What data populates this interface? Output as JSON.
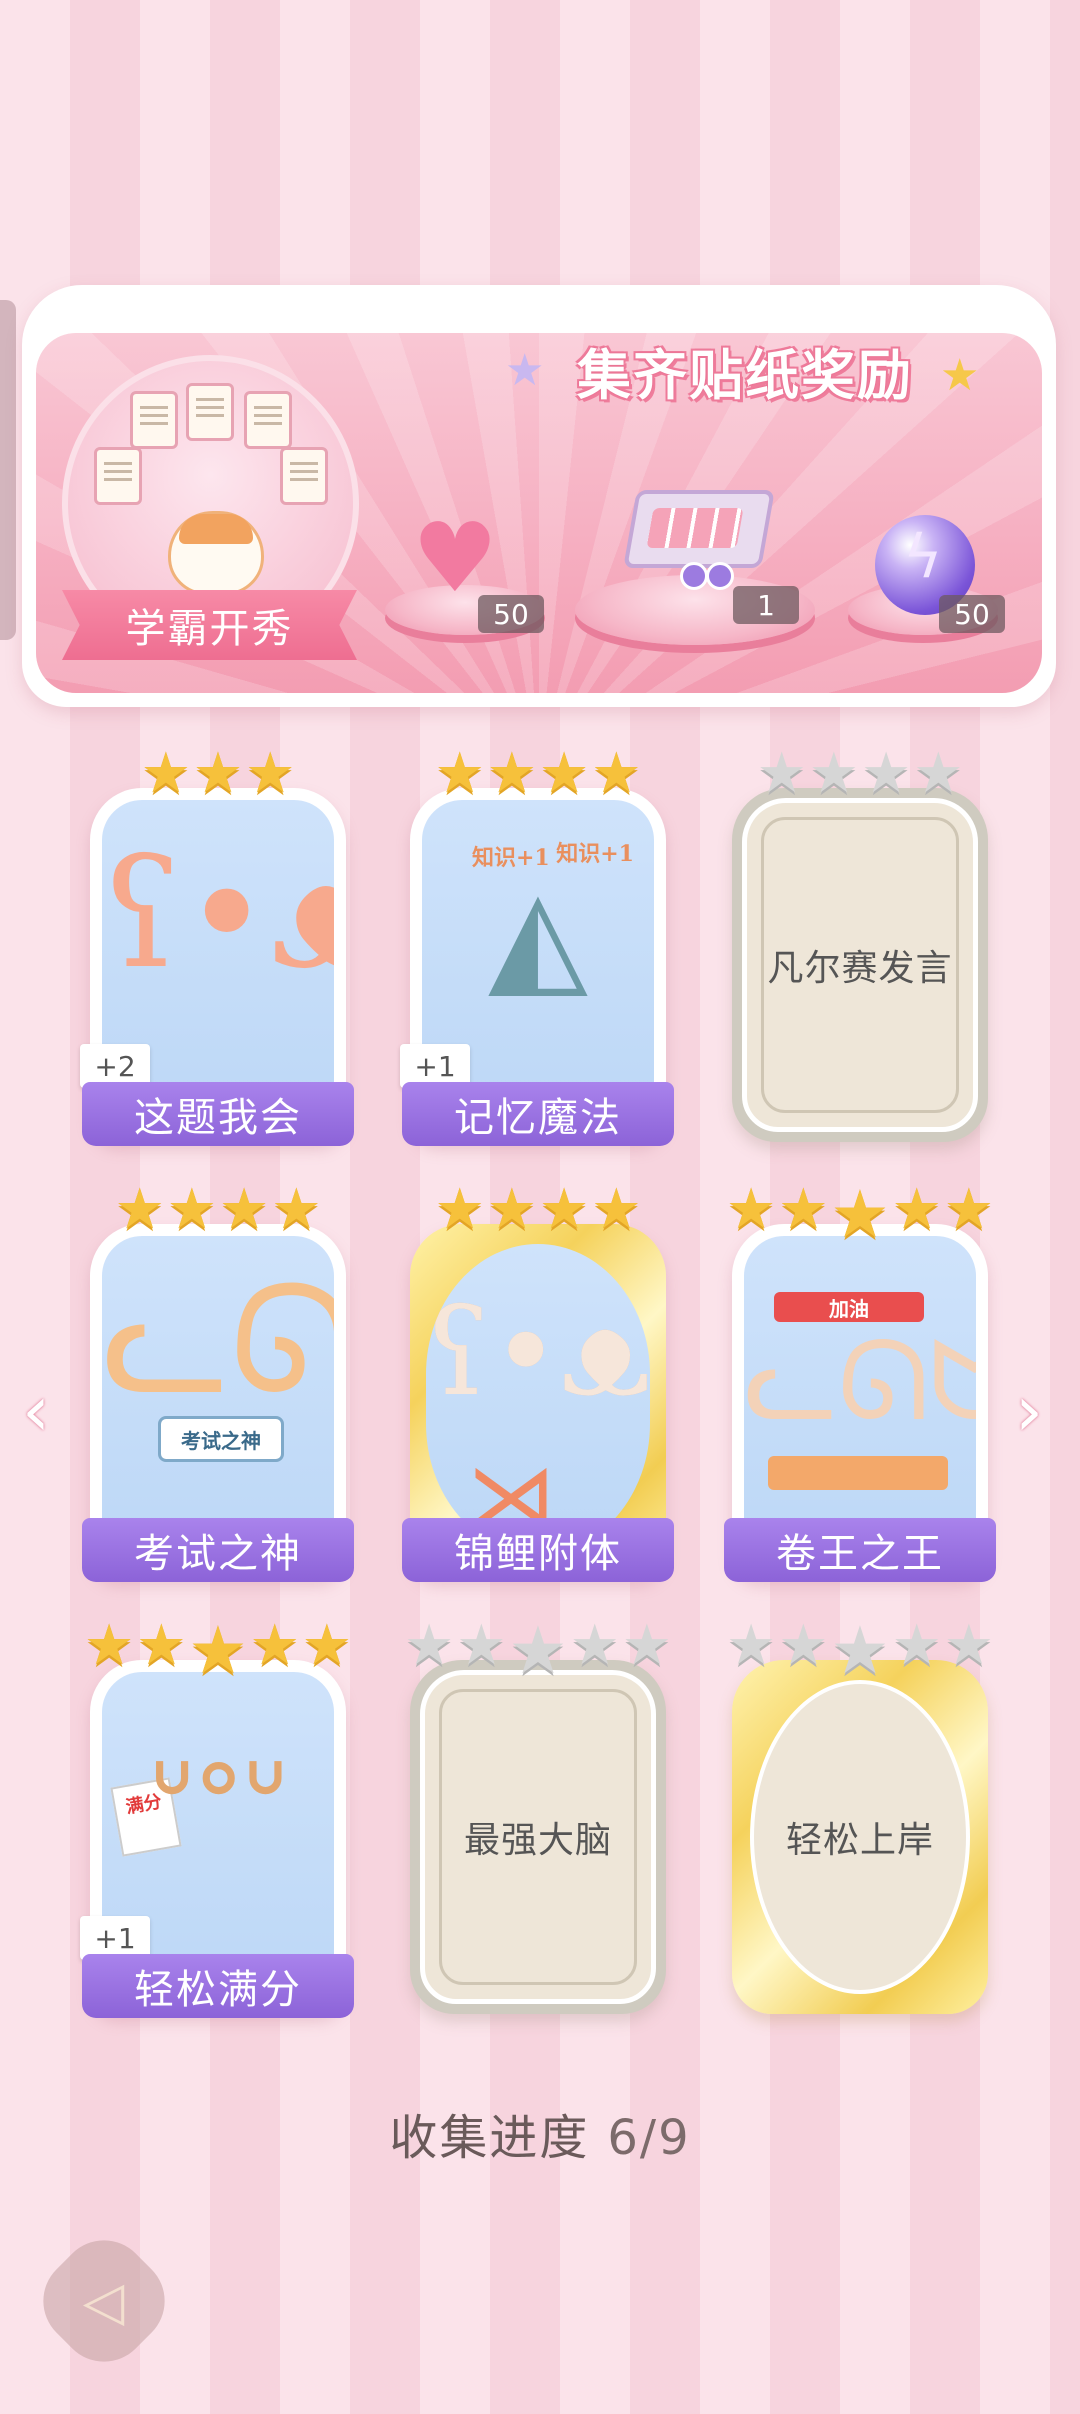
{
  "banner": {
    "title": "集齐贴纸奖励",
    "badge_label": "学霸开秀",
    "rewards": [
      {
        "icon": "pink-heart-gem-icon",
        "count": "50"
      },
      {
        "icon": "gift-box-icon",
        "count": "1"
      },
      {
        "icon": "lightning-orb-icon",
        "count": "50"
      }
    ]
  },
  "stickers": [
    {
      "name": "这题我会",
      "stars": 3,
      "unlocked": true,
      "badge": "+2",
      "icon": "bear-at-desk"
    },
    {
      "name": "记忆魔法",
      "stars": 4,
      "unlocked": true,
      "badge": "+1",
      "icon": "otter-wizard",
      "art_text": [
        "知识+1",
        "知识+1"
      ]
    },
    {
      "name": "凡尔赛发言",
      "stars": 4,
      "unlocked": false
    },
    {
      "name": "考试之神",
      "stars": 4,
      "unlocked": true,
      "icon": "angel-cat",
      "art_text": [
        "考试之神"
      ]
    },
    {
      "name": "锦鲤附体",
      "stars": 4,
      "unlocked": true,
      "icon": "bear-with-koi",
      "gold": true
    },
    {
      "name": "卷王之王",
      "stars": 5,
      "unlocked": true,
      "icon": "studying-cat",
      "art_text": [
        "加油"
      ]
    },
    {
      "name": "轻松满分",
      "stars": 5,
      "unlocked": true,
      "badge": "+1",
      "icon": "happy-dog",
      "art_text": [
        "满分"
      ]
    },
    {
      "name": "最强大脑",
      "stars": 5,
      "unlocked": false
    },
    {
      "name": "轻松上岸",
      "stars": 5,
      "unlocked": false,
      "gold": true
    }
  ],
  "progress": {
    "label": "收集进度",
    "value": "6/9"
  },
  "nav": {
    "prev_icon": "chevron-left-icon",
    "next_icon": "chevron-right-icon",
    "back_icon": "back-arrow-icon"
  },
  "colors": {
    "name_bar": "#8c63d8",
    "star_gold": "#f6c13b",
    "banner_pink": "#f6b0c2"
  }
}
